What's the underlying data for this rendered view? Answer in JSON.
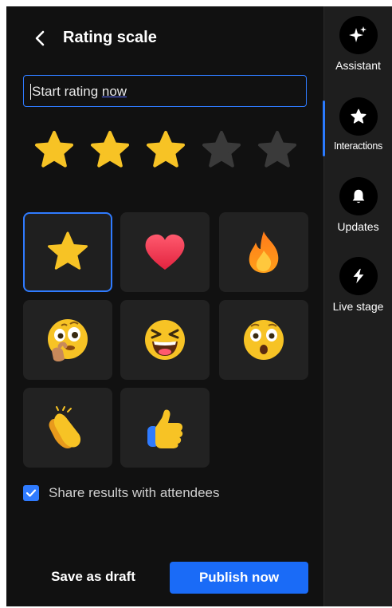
{
  "header": {
    "title": "Rating scale",
    "back_icon": "chevron-left-icon"
  },
  "title_input": {
    "value_prefix": "Start rating ",
    "value_suffix": "now"
  },
  "rating": {
    "total": 5,
    "filled": 3,
    "filled_color": "#f7c325",
    "empty_color": "#3a3a3a"
  },
  "reaction_options": [
    {
      "icon": "star-icon",
      "selected": true
    },
    {
      "icon": "heart-icon",
      "selected": false
    },
    {
      "icon": "fire-icon",
      "selected": false
    },
    {
      "icon": "thinking-face-icon",
      "selected": false
    },
    {
      "icon": "laughing-face-icon",
      "selected": false
    },
    {
      "icon": "surprised-face-icon",
      "selected": false
    },
    {
      "icon": "clapping-hands-icon",
      "selected": false
    },
    {
      "icon": "thumbs-up-icon",
      "selected": false
    }
  ],
  "share": {
    "checked": true,
    "label": "Share results with attendees"
  },
  "footer": {
    "draft_label": "Save as draft",
    "publish_label": "Publish now"
  },
  "rail": {
    "items": [
      {
        "label": "Assistant",
        "icon": "sparkle-icon",
        "active": false
      },
      {
        "label": "Interactions",
        "icon": "star-icon",
        "active": true
      },
      {
        "label": "Updates",
        "icon": "bell-icon",
        "active": false
      },
      {
        "label": "Live stage",
        "icon": "lightning-icon",
        "active": false
      }
    ]
  },
  "colors": {
    "accent": "#2f7bff",
    "publish": "#1a6bf7",
    "panel_bg": "#111111",
    "rail_bg": "#1e1e1e",
    "tile_bg": "#222222"
  }
}
